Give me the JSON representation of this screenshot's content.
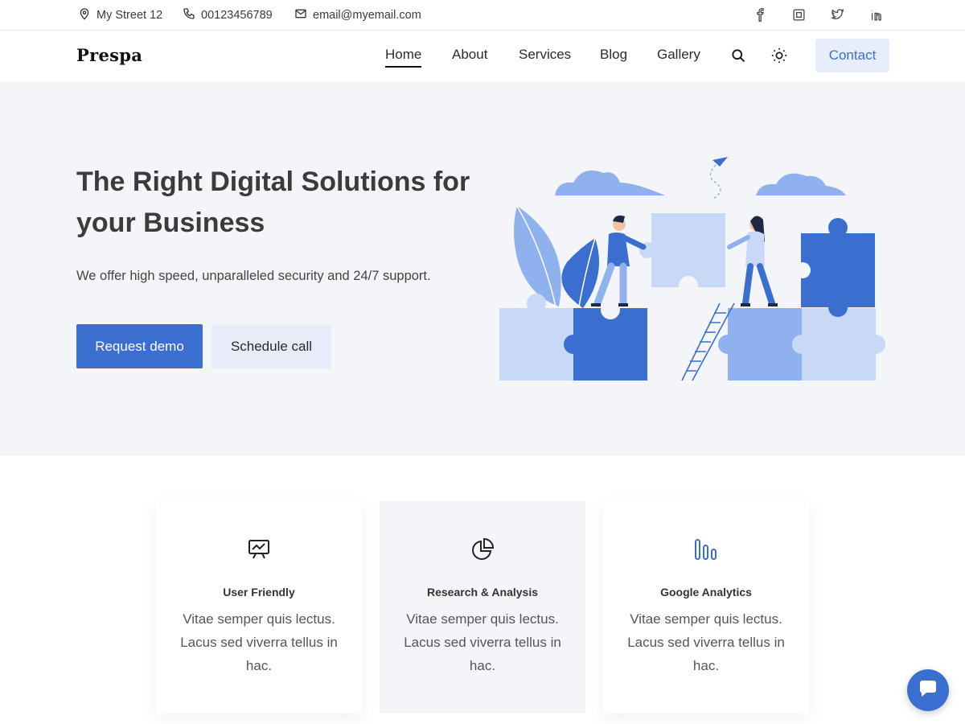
{
  "topbar": {
    "address": "My Street 12",
    "phone": "00123456789",
    "email": "email@myemail.com",
    "social": [
      "facebook-icon",
      "instagram-icon",
      "twitter-icon",
      "linkedin-icon"
    ]
  },
  "header": {
    "brand": "Prespa",
    "nav": [
      "Home",
      "About",
      "Services",
      "Blog",
      "Gallery"
    ],
    "active_nav": "Home",
    "contact_label": "Contact"
  },
  "hero": {
    "title": "The Right Digital Solutions for your Business",
    "subtitle": "We offer high speed, unparalleled security and 24/7 support.",
    "primary_button": "Request demo",
    "secondary_button": "Schedule call"
  },
  "features": [
    {
      "icon": "presentation-chart-icon",
      "title": "User Friendly",
      "text": "Vitae semper quis lectus. Lacus sed viverra tellus in hac."
    },
    {
      "icon": "pie-chart-icon",
      "title": "Research & Analysis",
      "text": "Vitae semper quis lectus. Lacus sed viverra tellus in hac."
    },
    {
      "icon": "bar-analytics-icon",
      "title": "Google Analytics",
      "text": "Vitae semper quis lectus. Lacus sed viverra tellus in hac."
    }
  ],
  "colors": {
    "accent": "#3a6fd0",
    "accent_light": "#e8edfb",
    "hero_bg": "#f4f5f9",
    "text": "#3b3b3b"
  }
}
